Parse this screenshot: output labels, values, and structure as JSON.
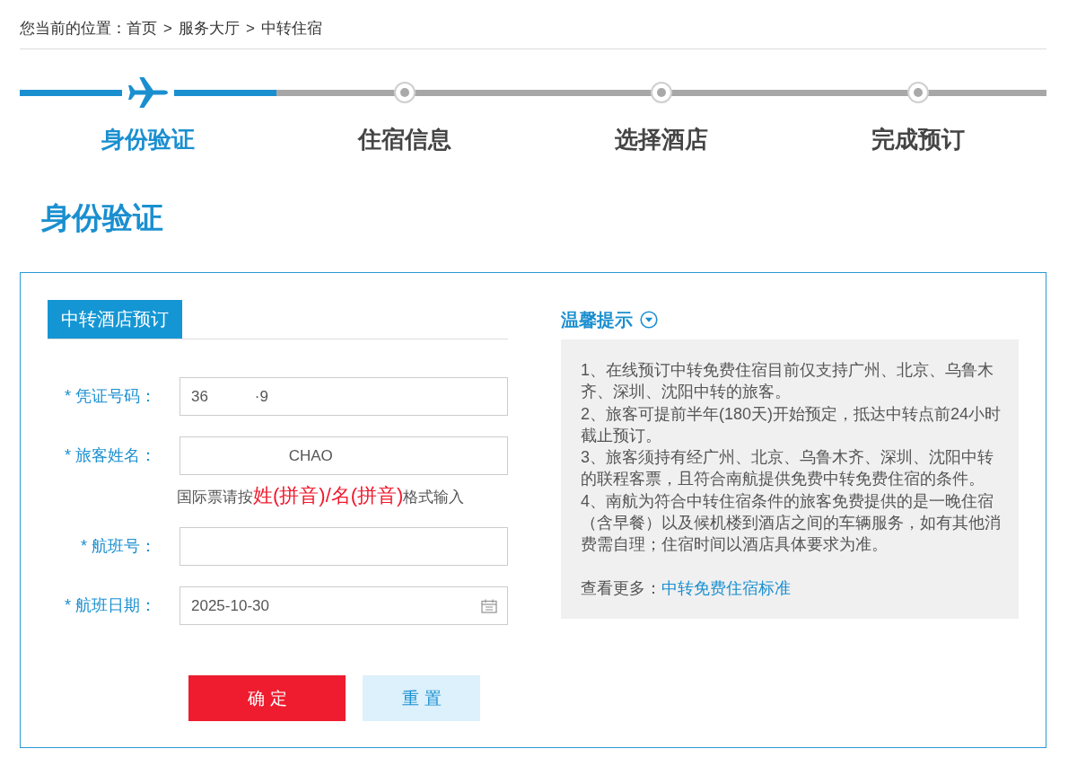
{
  "breadcrumb": {
    "label": "您当前的位置：",
    "separator": ">",
    "items": [
      "首页",
      "服务大厅",
      "中转住宿"
    ]
  },
  "steps": [
    {
      "label": "身份验证",
      "selected": true
    },
    {
      "label": "住宿信息",
      "selected": false
    },
    {
      "label": "选择酒店",
      "selected": false
    },
    {
      "label": "完成预订",
      "selected": false
    }
  ],
  "page_title": "身份验证",
  "form_panel": {
    "tab": "中转酒店预订",
    "fields": [
      {
        "kind": "text",
        "label": "* 凭证号码：",
        "value": "36           ·9"
      },
      {
        "kind": "text",
        "label": "* 旅客姓名：",
        "value": "                       CHAO",
        "hint": "国际票请按**姓(拼音)/名(拼音)**格式输入"
      },
      {
        "kind": "text",
        "label": "* 航班号："
      },
      {
        "kind": "date",
        "label": "* 航班日期：",
        "value": "2025-10-30"
      }
    ],
    "buttons": [
      {
        "kind": "primary",
        "label": "确定"
      },
      {
        "kind": "secondary",
        "label": "重置"
      }
    ]
  },
  "tips": {
    "title": "温馨提示",
    "items": [
      "1、在线预订中转免费住宿目前仅支持广州、北京、乌鲁木齐、深圳、沈阳中转的旅客。",
      "2、旅客可提前半年(180天)开始预定，抵达中转点前24小时截止预订。",
      "3、旅客须持有经广州、北京、乌鲁木齐、深圳、沈阳中转的联程客票，且符合南航提供免费中转免费住宿的条件。",
      "4、南航为符合中转住宿条件的旅客免费提供的是一晚住宿（含早餐）以及候机楼到酒店之间的车辆服务，如有其他消费需自理；住宿时间以酒店具体要求为准。"
    ],
    "more_label": "查看更多：",
    "more_link": "中转免费住宿标准"
  }
}
